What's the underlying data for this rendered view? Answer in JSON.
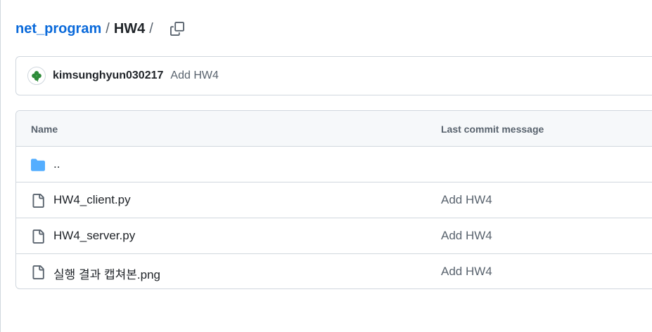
{
  "breadcrumb": {
    "repo": "net_program",
    "separator": "/",
    "current": "HW4",
    "trailing_separator": "/"
  },
  "commit": {
    "author": "kimsunghyun030217",
    "message": "Add HW4",
    "avatar_icon": "four-leaf-clover-icon"
  },
  "table": {
    "headers": {
      "name": "Name",
      "last_commit_message": "Last commit message"
    },
    "parent_row": {
      "name": "..",
      "icon": "folder-icon"
    },
    "files": [
      {
        "name": "HW4_client.py",
        "message": "Add HW4",
        "icon": "file-icon"
      },
      {
        "name": "HW4_server.py",
        "message": "Add HW4",
        "icon": "file-icon"
      },
      {
        "name": "실행 결과 캡쳐본.png",
        "message": "Add HW4",
        "icon": "file-icon"
      }
    ]
  },
  "colors": {
    "link": "#0969da",
    "text": "#1f2328",
    "muted": "#59636e",
    "border": "#d0d7de",
    "header_bg": "#f6f8fa",
    "folder": "#54aeff"
  }
}
